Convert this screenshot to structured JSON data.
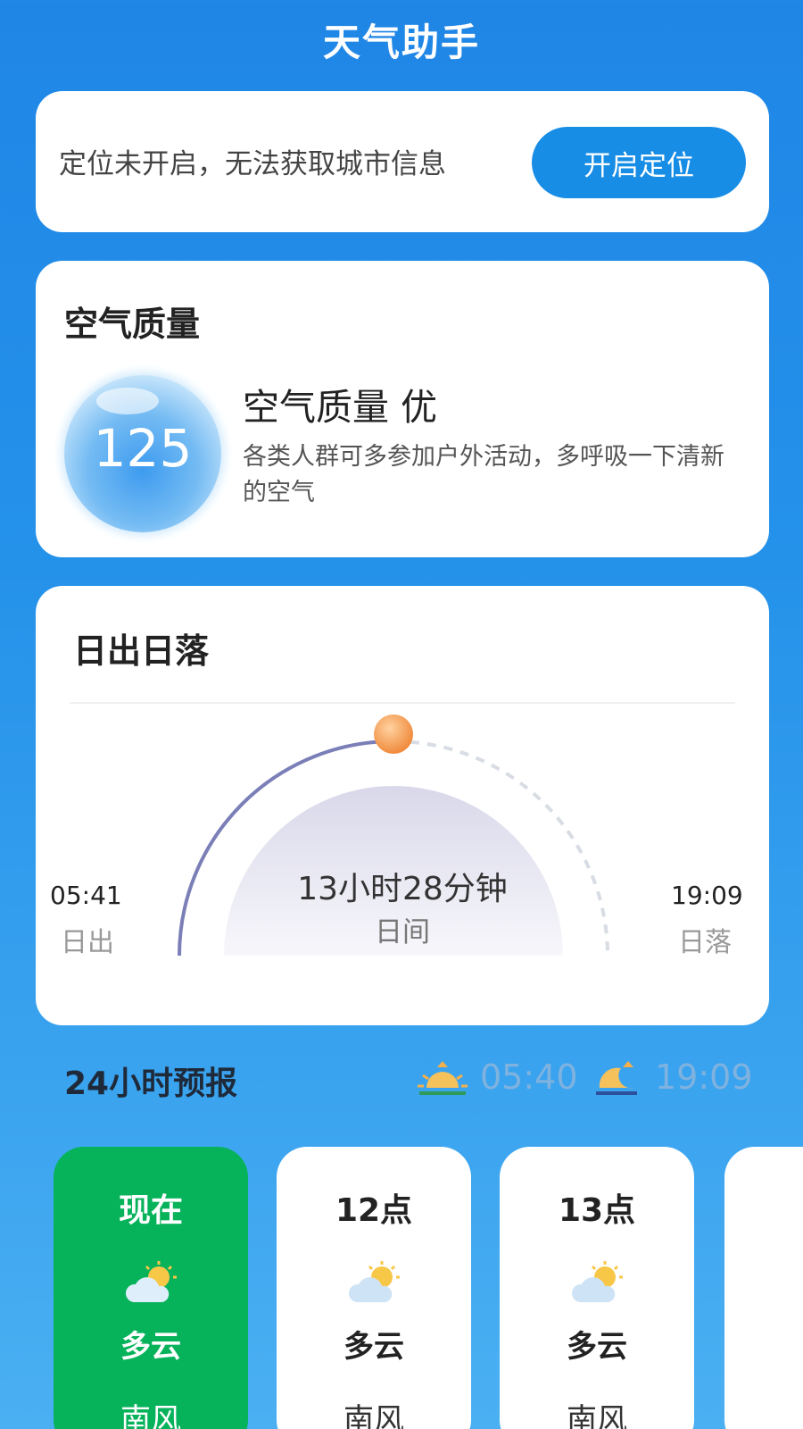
{
  "header": {
    "title": "天气助手"
  },
  "location": {
    "message": "定位未开启，无法获取城市信息",
    "button_label": "开启定位"
  },
  "air_quality": {
    "title": "空气质量",
    "aqi": "125",
    "level_text": "空气质量 优",
    "description": "各类人群可多参加户外活动，多呼吸一下清新的空气"
  },
  "sun": {
    "title": "日出日落",
    "sunrise_time": "05:41",
    "sunrise_label": "日出",
    "sunset_time": "19:09",
    "sunset_label": "日落",
    "day_length": "13小时28分钟",
    "day_label": "日间",
    "colors": {
      "elapsed_arc": "#7b7fb7",
      "remaining_arc": "#d8dce3",
      "sun": "#f5a15a"
    }
  },
  "forecast": {
    "title": "24小时预报",
    "sunrise_icon": "sunrise-icon",
    "sunrise_time": "05:40",
    "sunset_icon": "moonrise-icon",
    "sunset_time": "19:09",
    "hours": [
      {
        "time": "现在",
        "icon": "partly-cloudy-icon",
        "condition": "多云",
        "wind": "南风"
      },
      {
        "time": "12点",
        "icon": "partly-cloudy-icon",
        "condition": "多云",
        "wind": "南风"
      },
      {
        "time": "13点",
        "icon": "partly-cloudy-icon",
        "condition": "多云",
        "wind": "南风"
      }
    ]
  },
  "colors": {
    "now_card": "#06b25a",
    "button": "#178de6"
  }
}
